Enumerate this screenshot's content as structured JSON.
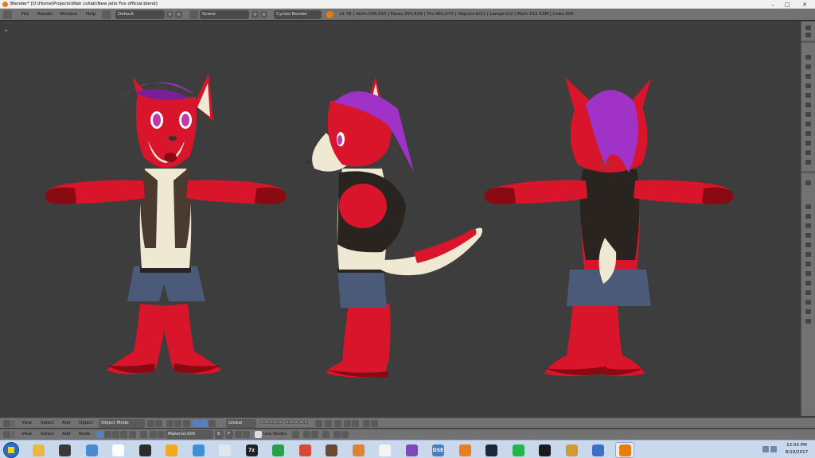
{
  "window": {
    "title": "Blender* [D:\\Home\\Projects\\Wah collab\\New jello Fox official.blend]",
    "controls": [
      "–",
      "□",
      "✕"
    ]
  },
  "infobar": {
    "menus": [
      "File",
      "Render",
      "Window",
      "Help"
    ],
    "screen_layout": "Default",
    "scene": "Scene",
    "render_engine": "Cycles Render",
    "stats": "v2.78 | Verts:236,010 | Faces:355,629 | Tris:461,670 | Objects:6/21 | Lamps:0/2 | Mem:152.53M | Cube.005"
  },
  "view_header": {
    "menus": [
      "View",
      "Select",
      "Add",
      "Object"
    ],
    "mode": "Object Mode",
    "orientation": "Global"
  },
  "node_header": {
    "menus": [
      "View",
      "Select",
      "Add",
      "Node"
    ],
    "material": "Material.005",
    "users": "6",
    "fake_user": "F",
    "use_nodes_label": "Use Nodes"
  },
  "taskbar": {
    "apps": [
      {
        "name": "folder",
        "label": "",
        "color": "#e8b93c"
      },
      {
        "name": "app-dark",
        "label": "",
        "color": "#3a3a3a"
      },
      {
        "name": "recycle",
        "label": "",
        "color": "#4a8ad0"
      },
      {
        "name": "app-cat",
        "label": "",
        "color": "#ffffff"
      },
      {
        "name": "app-circle",
        "label": "",
        "color": "#2d2d2d"
      },
      {
        "name": "headphones",
        "label": "",
        "color": "#f3a81e"
      },
      {
        "name": "app-drop",
        "label": "",
        "color": "#3d8fd6"
      },
      {
        "name": "app-grid",
        "label": "",
        "color": "#dfe6ee"
      },
      {
        "name": "7zip",
        "label": "7z",
        "color": "#222222"
      },
      {
        "name": "app-green",
        "label": "",
        "color": "#2b9e4a"
      },
      {
        "name": "chrome",
        "label": "",
        "color": "#d64937"
      },
      {
        "name": "app-brown",
        "label": "",
        "color": "#6a4a2e"
      },
      {
        "name": "app-orange",
        "label": "",
        "color": "#e0832f"
      },
      {
        "name": "app-white",
        "label": "",
        "color": "#f4f4f4"
      },
      {
        "name": "app-purple",
        "label": "",
        "color": "#7a4ab8"
      },
      {
        "name": "dsb",
        "label": "DSE",
        "color": "#4b7dc2"
      },
      {
        "name": "app-player",
        "label": "",
        "color": "#e87d22"
      },
      {
        "name": "steam",
        "label": "",
        "color": "#1b2838"
      },
      {
        "name": "app-razer",
        "label": "",
        "color": "#25b34a"
      },
      {
        "name": "app-figure",
        "label": "",
        "color": "#1a1a1a"
      },
      {
        "name": "app-lion",
        "label": "",
        "color": "#d39a2e"
      },
      {
        "name": "app-doc",
        "label": "",
        "color": "#3d70c2"
      },
      {
        "name": "blender",
        "label": "",
        "color": "#e87d0d"
      }
    ],
    "clock_time": "12:03 PM",
    "clock_date": "8/10/2017"
  },
  "colors": {
    "viewport_bg": "#3d3d3d",
    "header_bg": "#727272",
    "fox_red": "#e0152a",
    "fox_dark_red": "#8a0a14",
    "fox_cream": "#efe8d2",
    "hair_purple": "#a032c8",
    "vest": "#4a3a30",
    "shorts": "#4a5a78"
  }
}
